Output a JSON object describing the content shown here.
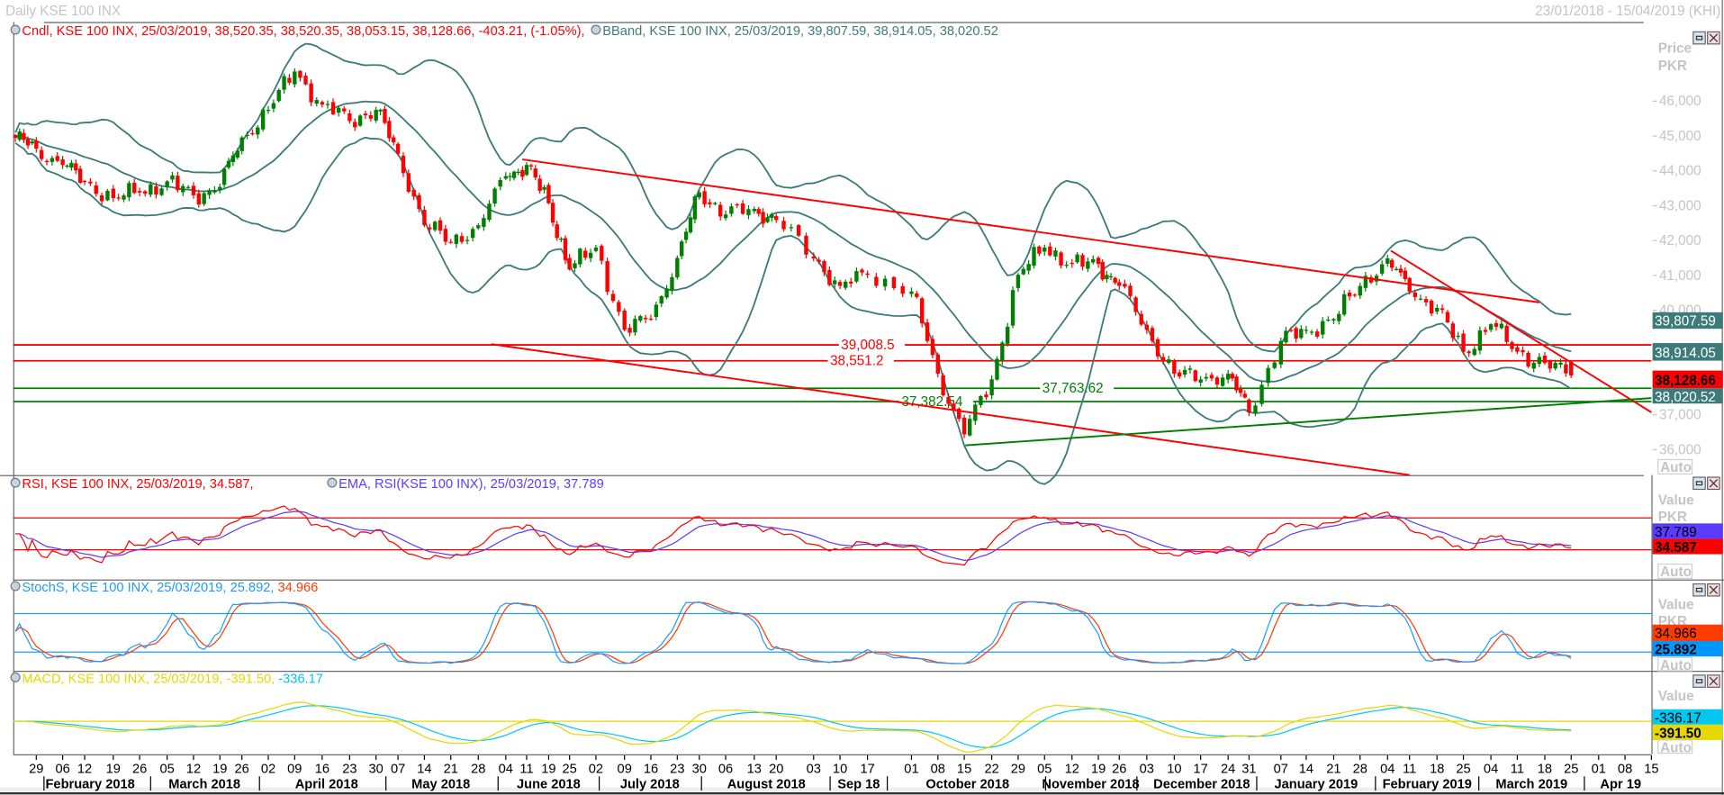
{
  "window": {
    "title": "Daily KSE 100 INX",
    "range": "23/01/2018 - 15/04/2019 (KHI)"
  },
  "main_panel": {
    "legend_cndl": "Cndl, KSE 100 INX, 25/03/2019, 38,520.35, 38,520.35, 38,053.15, 38,128.66, -403.21, (-1.05%),",
    "legend_bband": "BBand, KSE 100 INX, 25/03/2019, 39,807.59, 38,914.05, 38,020.52",
    "axis_title": "Price",
    "axis_unit": "PKR",
    "ticks": [
      "46,000",
      "45,000",
      "44,000",
      "43,000",
      "42,000",
      "41,000",
      "40,000",
      "37,000",
      "36,000"
    ],
    "label_bb_upper": "39,807.59",
    "label_bb_middle": "38,914.05",
    "label_last": "38,128.66",
    "label_bb_lower": "38,020.52",
    "auto": "Auto",
    "colors": {
      "up": "#008000",
      "down": "#ff0000",
      "bband": "#3d7b7b",
      "last": "#ff0000"
    }
  },
  "drawings": {
    "levels": [
      {
        "label": "39,008.5",
        "value": 39008.5,
        "color": "#ff0000"
      },
      {
        "label": "38,551.2",
        "value": 38551.2,
        "color": "#ff0000"
      },
      {
        "label": "37,763.62",
        "value": 37763.62,
        "color": "#008000"
      },
      {
        "label": "37,382.54",
        "value": 37382.54,
        "color": "#008000"
      }
    ]
  },
  "rsi_panel": {
    "legend_rsi": "RSI, KSE 100 INX, 25/03/2019, 34.587,",
    "legend_ema": "EMA, RSI(KSE 100 INX), 25/03/2019, 37.789",
    "axis_title": "Value",
    "axis_unit": "PKR",
    "label_ema": "37.789",
    "label_rsi": "34.587",
    "auto": "Auto",
    "levels": [
      70,
      30
    ]
  },
  "stoch_panel": {
    "legend_main": "StochS, KSE 100 INX, 25/03/2019, 25.892,",
    "legend_d": "34.966",
    "axis_title": "Value",
    "axis_unit": "PKR",
    "label_d": "34.966",
    "label_k": "25.892",
    "auto": "Auto",
    "levels": [
      80,
      20
    ]
  },
  "macd_panel": {
    "legend_main": "MACD, KSE 100 INX, 25/03/2019, -391.50,",
    "legend_signal": "-336.17",
    "axis_title": "Value",
    "label_signal": "-336.17",
    "label_macd": "-391.50",
    "auto": "Auto"
  },
  "date_axis": {
    "days": [
      "29",
      "06",
      "12",
      "19",
      "26",
      "05",
      "12",
      "19",
      "26",
      "02",
      "09",
      "16",
      "23",
      "30",
      "07",
      "14",
      "21",
      "28",
      "04",
      "11",
      "19",
      "25",
      "02",
      "09",
      "16",
      "23",
      "30",
      "06",
      "13",
      "20",
      "03",
      "10",
      "17",
      "01",
      "08",
      "15",
      "22",
      "29",
      "05",
      "12",
      "19",
      "26",
      "03",
      "10",
      "17",
      "24",
      "31",
      "07",
      "14",
      "21",
      "28",
      "04",
      "11",
      "18",
      "25",
      "04",
      "11",
      "18",
      "25",
      "01",
      "08",
      "15"
    ],
    "months": [
      "February 2018",
      "March 2018",
      "April 2018",
      "May 2018",
      "June 2018",
      "July 2018",
      "August 2018",
      "Sep 18",
      "October 2018",
      "November 2018",
      "December 2018",
      "January 2019",
      "February 2019",
      "March 2019",
      "Apr 19"
    ]
  },
  "chart_data": {
    "type": "candlestick",
    "title": "Daily KSE 100 INX",
    "period": "23/01/2018 - 25/03/2019",
    "ylabel": "Price PKR",
    "ylim": [
      35600,
      47000
    ],
    "last_candle": {
      "date": "25/03/2019",
      "open": 38520.35,
      "high": 38520.35,
      "low": 38053.15,
      "close": 38128.66,
      "change": -403.21,
      "change_pct": -1.05
    },
    "bollinger_last": {
      "upper": 39807.59,
      "middle": 38914.05,
      "lower": 38020.52
    },
    "weekly_close_approx": [
      44950,
      44640,
      44170,
      43700,
      43220,
      43380,
      43700,
      43300,
      43540,
      44960,
      45750,
      46850,
      45900,
      45430,
      45750,
      44490,
      42440,
      41960,
      42440,
      43850,
      44170,
      43070,
      41170,
      41800,
      39440,
      39750,
      41500,
      43380,
      42750,
      42910,
      42590,
      41490,
      40700,
      41020,
      40540,
      38180,
      36440,
      38020,
      41020,
      41800,
      41330,
      41330,
      40700,
      39440,
      38180,
      38020,
      38180,
      37070,
      39120,
      39440,
      39750,
      40700,
      41490,
      40540,
      40070,
      38810,
      39600,
      38810,
      38490,
      38128.66
    ],
    "indicators": {
      "rsi": 34.587,
      "rsi_ema": 37.789,
      "stoch_k": 25.892,
      "stoch_d": 34.966,
      "macd": -391.5,
      "macd_signal": -336.17
    }
  }
}
